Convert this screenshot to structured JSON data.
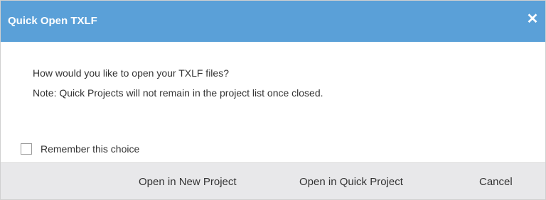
{
  "dialog": {
    "title": "Quick Open TXLF",
    "close_glyph": "✕",
    "message_line1": "How would you like to open your TXLF files?",
    "message_line2": "Note: Quick Projects will not remain in the project list once closed.",
    "remember_label": "Remember this choice",
    "remember_checked": false,
    "buttons": {
      "open_new": "Open in New Project",
      "open_quick": "Open in Quick Project",
      "cancel": "Cancel"
    },
    "colors": {
      "titlebar": "#5aa0d8",
      "footer": "#e8e8ea"
    }
  }
}
